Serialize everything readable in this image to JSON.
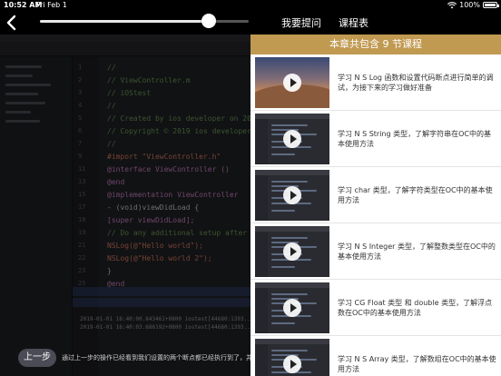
{
  "status_bar": {
    "time": "10:52 AM",
    "date": "Fri Feb 1",
    "battery_percent": "100%",
    "battery_level": 1.0
  },
  "player": {
    "progress": 0.81,
    "tabs": {
      "question": "我要提问",
      "schedule": "课程表"
    },
    "prev_button": "上一步",
    "subtitle": "通过上一步的操作已经看到我们设置的两个断点都已经执行到了，并且在控制台中"
  },
  "code": {
    "lines": [
      {
        "n": "1",
        "text": "//",
        "color": "#6a9955"
      },
      {
        "n": "2",
        "text": "//  ViewController.m",
        "color": "#6a9955"
      },
      {
        "n": "3",
        "text": "//  iOStest",
        "color": "#6a9955"
      },
      {
        "n": "4",
        "text": "//",
        "color": "#6a9955"
      },
      {
        "n": "5",
        "text": "//  Created by ios developer on 2019",
        "color": "#6a9955"
      },
      {
        "n": "6",
        "text": "//  Copyright © 2019 ios developer. A",
        "color": "#6a9955"
      },
      {
        "n": "7",
        "text": "//",
        "color": "#6a9955"
      },
      {
        "n": "9",
        "text": "#import \"ViewController.h\"",
        "color": "#d67a60"
      },
      {
        "n": "11",
        "text": "@interface ViewController ()",
        "color": "#c87fc0"
      },
      {
        "n": "13",
        "text": "@end",
        "color": "#c87fc0"
      },
      {
        "n": "15",
        "text": "@implementation ViewController",
        "color": "#c87fc0"
      },
      {
        "n": "17",
        "text": "- (void)viewDidLoad {",
        "color": "#c8c8c8"
      },
      {
        "n": "18",
        "text": "    [super viewDidLoad];",
        "color": "#c87fc0"
      },
      {
        "n": "19",
        "text": "    // Do any additional setup after lo",
        "color": "#6a9955"
      },
      {
        "n": "21",
        "text": "    NSLog(@\"Hello world\");",
        "color": "#d67a60"
      },
      {
        "n": "22",
        "text": "    NSLog(@\"Hello world 2\");",
        "color": "#d67a60"
      },
      {
        "n": "23",
        "text": "}",
        "color": "#c8c8c8"
      },
      {
        "n": "25",
        "text": "@end",
        "color": "#c87fc0"
      }
    ],
    "console": [
      "2019-01-01 16:40:00.843461+0800 iostest[44680:1393...",
      "2019-01-01 16:40:03.686192+0800 iostest[44680:1393..."
    ]
  },
  "lesson_panel": {
    "header": "本章共包含 9 节课程",
    "lessons": [
      {
        "title": "学习 N S Log 函数和设置代码断点进行简单的调试，为接下来的学习做好准备",
        "thumb": "desert"
      },
      {
        "title": "学习 N S String 类型，了解字符串在OC中的基本使用方法",
        "thumb": "code"
      },
      {
        "title": "学习 char 类型，了解字符类型在OC中的基本使用方法",
        "thumb": "code"
      },
      {
        "title": "学习 N S Integer 类型，了解整数类型在OC中的基本使用方法",
        "thumb": "code"
      },
      {
        "title": "学习 CG Float 类型 和 double 类型，了解浮点数在OC中的基本使用方法",
        "thumb": "code"
      },
      {
        "title": "学习 N S Array 类型，了解数组在OC中的基本使用方法",
        "thumb": "code"
      }
    ]
  }
}
